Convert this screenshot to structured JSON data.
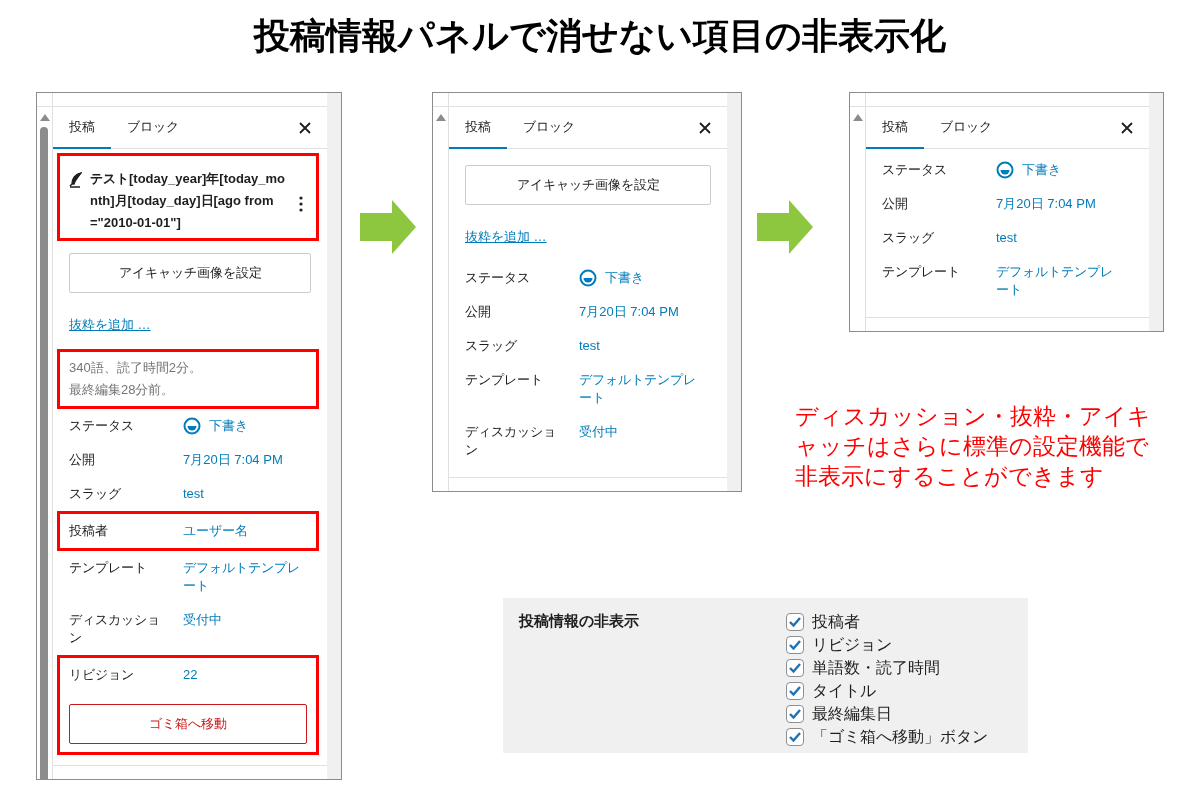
{
  "title": "投稿情報パネルで消せない項目の非表示化",
  "panels": [
    {
      "scrollbar_thumb": true,
      "tabs": [
        {
          "label": "投稿",
          "selected": true
        },
        {
          "label": "ブロック",
          "selected": false
        }
      ],
      "items": [
        {
          "kind": "post_title",
          "text": "テスト[today_year]年[today_month]月[today_day]日[ago from=\"2010-01-01\"]",
          "highlighted": true
        },
        {
          "kind": "button",
          "text": "アイキャッチ画像を設定",
          "highlighted": false
        },
        {
          "kind": "link",
          "text": "抜粋を追加 …",
          "highlighted": false
        },
        {
          "kind": "meta",
          "lines": [
            "340語、読了時間2分。",
            "最終編集28分前。"
          ],
          "highlighted": true
        },
        {
          "kind": "status_row",
          "label": "ステータス",
          "value": "下書き",
          "highlighted": false
        },
        {
          "kind": "row",
          "label": "公開",
          "value": "7月20日 7:04 PM",
          "highlighted": false
        },
        {
          "kind": "row",
          "label": "スラッグ",
          "value": "test",
          "highlighted": false
        },
        {
          "kind": "row",
          "label": "投稿者",
          "value": "ユーザー名",
          "highlighted": true
        },
        {
          "kind": "row",
          "label": "テンプレート",
          "value": "デフォルトテンプレート",
          "highlighted": false
        },
        {
          "kind": "row",
          "label": "ディスカッション",
          "value": "受付中",
          "highlighted": false
        },
        {
          "kind": "row",
          "label": "リビジョン",
          "value": "22",
          "highlighted": true
        },
        {
          "kind": "danger_button",
          "text": "ゴミ箱へ移動",
          "highlighted": true
        }
      ]
    },
    {
      "scrollbar_thumb": false,
      "tabs": [
        {
          "label": "投稿",
          "selected": true
        },
        {
          "label": "ブロック",
          "selected": false
        }
      ],
      "items": [
        {
          "kind": "button",
          "text": "アイキャッチ画像を設定",
          "highlighted": false
        },
        {
          "kind": "link",
          "text": "抜粋を追加 …",
          "highlighted": false
        },
        {
          "kind": "status_row",
          "label": "ステータス",
          "value": "下書き",
          "highlighted": false
        },
        {
          "kind": "row",
          "label": "公開",
          "value": "7月20日 7:04 PM",
          "highlighted": false
        },
        {
          "kind": "row",
          "label": "スラッグ",
          "value": "test",
          "highlighted": false
        },
        {
          "kind": "row",
          "label": "テンプレート",
          "value": "デフォルトテンプレート",
          "highlighted": false
        },
        {
          "kind": "row",
          "label": "ディスカッション",
          "value": "受付中",
          "highlighted": false
        }
      ]
    },
    {
      "scrollbar_thumb": false,
      "tabs": [
        {
          "label": "投稿",
          "selected": true
        },
        {
          "label": "ブロック",
          "selected": false
        }
      ],
      "items": [
        {
          "kind": "status_row",
          "label": "ステータス",
          "value": "下書き",
          "highlighted": false
        },
        {
          "kind": "row",
          "label": "公開",
          "value": "7月20日 7:04 PM",
          "highlighted": false
        },
        {
          "kind": "row",
          "label": "スラッグ",
          "value": "test",
          "highlighted": false
        },
        {
          "kind": "row",
          "label": "テンプレート",
          "value": "デフォルトテンプレート",
          "highlighted": false
        }
      ]
    }
  ],
  "note": "ディスカッション・抜粋・アイキャッチはさらに標準の設定機能で非表示にすることができます",
  "settings": {
    "heading": "投稿情報の非表示",
    "options": [
      {
        "label": "投稿者",
        "checked": true
      },
      {
        "label": "リビジョン",
        "checked": true
      },
      {
        "label": "単語数・読了時間",
        "checked": true
      },
      {
        "label": "タイトル",
        "checked": true
      },
      {
        "label": "最終編集日",
        "checked": true
      },
      {
        "label": "「ゴミ箱へ移動」ボタン",
        "checked": true
      }
    ]
  }
}
